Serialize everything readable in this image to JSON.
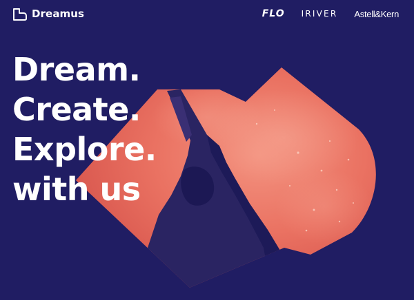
{
  "header": {
    "logo_text": "Dreamus",
    "brands": [
      {
        "label": "FLO"
      },
      {
        "label": "IRIVER"
      },
      {
        "label": "Astell&Kern"
      }
    ]
  },
  "hero": {
    "headline_lines": [
      "Dream.",
      "Create.",
      "Explore.",
      "with us"
    ]
  },
  "colors": {
    "background": "#201d63",
    "accent": "#ee7766",
    "text": "#ffffff"
  }
}
